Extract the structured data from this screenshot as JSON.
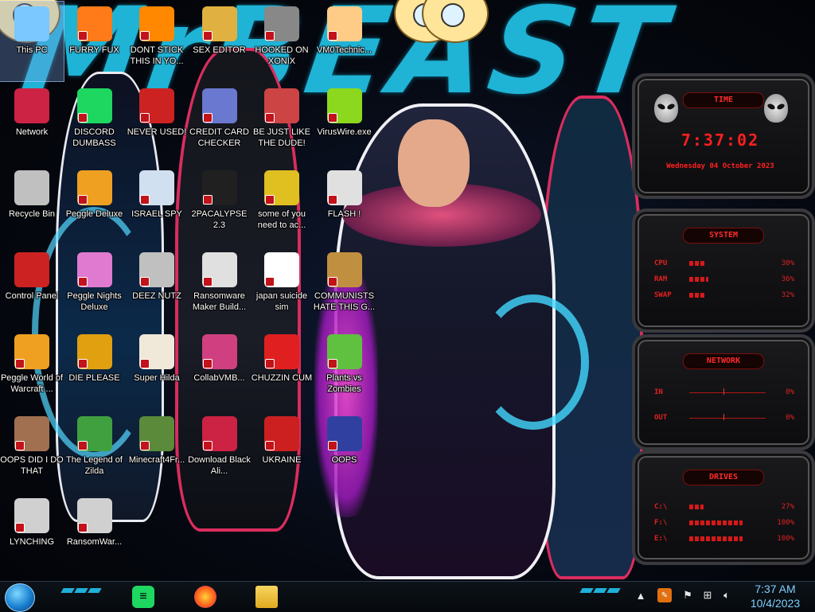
{
  "wallpaper": {
    "title": "MrBEAST"
  },
  "desktop": {
    "icons": [
      {
        "label": "This PC",
        "icon": "this-pc-icon",
        "color": "#7ac8ff"
      },
      {
        "label": "FURRY FUX",
        "icon": "firefox-icon",
        "color": "#ff7a18"
      },
      {
        "label": "DONT STICK THIS IN YO...",
        "icon": "vlc-cone-icon",
        "color": "#ff8800"
      },
      {
        "label": "SEX EDITOR",
        "icon": "hex-editor-icon",
        "color": "#e0b040"
      },
      {
        "label": "HOOKED ON XONIX",
        "icon": "xonix-game-icon",
        "color": "#888888"
      },
      {
        "label": "VM0Technic...",
        "icon": "doctor-icon",
        "color": "#ffcc88"
      },
      {
        "label": "Network",
        "icon": "network-icon",
        "color": "#cc2244"
      },
      {
        "label": "DISCORD DUMBASS",
        "icon": "spotify-icon",
        "color": "#1ed760"
      },
      {
        "label": "NEVER USED!",
        "icon": "dev-cpp-icon",
        "color": "#cc2222"
      },
      {
        "label": "CREDIT CARD CHECKER",
        "icon": "credit-card-icon",
        "color": "#6a78d0"
      },
      {
        "label": "BE JUST LIKE THE DUDE!",
        "icon": "elf-face-icon",
        "color": "#cc4444"
      },
      {
        "label": "VirusWire.exe",
        "icon": "lime-icon",
        "color": "#8bd81e"
      },
      {
        "label": "Recycle Bin",
        "icon": "recycle-bin-icon",
        "color": "#c0c0c0"
      },
      {
        "label": "Peggle Deluxe",
        "icon": "peggle-icon",
        "color": "#f0a020"
      },
      {
        "label": "ISRAEL SPY",
        "icon": "spy-app-icon",
        "color": "#d0e0f0"
      },
      {
        "label": "2PACALYPSE 2.3",
        "icon": "terminal-icon",
        "color": "#202020"
      },
      {
        "label": "some of you need to ac...",
        "icon": "beaver-icon",
        "color": "#e0c020"
      },
      {
        "label": "FLASH !",
        "icon": "flash-doc-icon",
        "color": "#e0e0e0"
      },
      {
        "label": "Control Panel",
        "icon": "control-panel-icon",
        "color": "#cc2222"
      },
      {
        "label": "Peggle Nights Deluxe",
        "icon": "peggle-nights-icon",
        "color": "#e07ad0"
      },
      {
        "label": "DEEZ NUTZ",
        "icon": "windows-stack-icon",
        "color": "#c0c0c0"
      },
      {
        "label": "Ransomware Maker Build...",
        "icon": "builder-window-icon",
        "color": "#e0e0e0"
      },
      {
        "label": "japan suicide sim",
        "icon": "document-icon",
        "color": "#ffffff"
      },
      {
        "label": "COMMUNISTS HATE THIS G...",
        "icon": "money-bag-icon",
        "color": "#c09040"
      },
      {
        "label": "Peggle World of Warcraft ...",
        "icon": "peggle-wow-icon",
        "color": "#f0a020"
      },
      {
        "label": "DIE PLEASE",
        "icon": "die-icon",
        "color": "#e0a010"
      },
      {
        "label": "Super Hilda",
        "icon": "pixel-sprite-icon",
        "color": "#f0e8d8"
      },
      {
        "label": "CollabVMB...",
        "icon": "computer-screen-icon",
        "color": "#d04080"
      },
      {
        "label": "CHUZZIN CUM",
        "icon": "chuzzle-icon",
        "color": "#e02020"
      },
      {
        "label": "Plants vs Zombies",
        "icon": "plant-icon",
        "color": "#60c040"
      },
      {
        "label": "OOPS DID I DO THAT",
        "icon": "portrait-icon",
        "color": "#a07050"
      },
      {
        "label": "The Legend of Zilda",
        "icon": "pixel-hero-icon",
        "color": "#40a040"
      },
      {
        "label": "Minecraft4Fr...",
        "icon": "grass-block-icon",
        "color": "#5a8a3a"
      },
      {
        "label": "Download Black Ali...",
        "icon": "alien-orb-icon",
        "color": "#cc2244"
      },
      {
        "label": "UKRAINE",
        "icon": "radiation-icon",
        "color": "#cc2020"
      },
      {
        "label": "OOPS",
        "icon": "oops-icon",
        "color": "#3040a0"
      },
      {
        "label": "LYNCHING",
        "icon": "knot-icon",
        "color": "#d0d0d0"
      },
      {
        "label": "RansomWar...",
        "icon": "skull-icon",
        "color": "#d0d0d0"
      }
    ]
  },
  "gadgets": {
    "time": {
      "title": "TIME",
      "clock": "7:37:02",
      "date": "Wednesday 04 October 2023"
    },
    "system": {
      "title": "SYSTEM",
      "rows": [
        {
          "label": "CPU",
          "value": "30%",
          "fill": 0.3
        },
        {
          "label": "RAM",
          "value": "36%",
          "fill": 0.36
        },
        {
          "label": "SWAP",
          "value": "32%",
          "fill": 0.32
        }
      ]
    },
    "network": {
      "title": "NETWORK",
      "rows": [
        {
          "label": "IN",
          "value": "0%"
        },
        {
          "label": "OUT",
          "value": "0%"
        }
      ]
    },
    "drives": {
      "title": "DRIVES",
      "rows": [
        {
          "label": "C:\\",
          "value": "27%",
          "fill": 0.27
        },
        {
          "label": "F:\\",
          "value": "100%",
          "fill": 1.0
        },
        {
          "label": "E:\\",
          "value": "100%",
          "fill": 1.0
        }
      ]
    }
  },
  "taskbar": {
    "pinned": [
      {
        "name": "spotify",
        "icon": "spotify-icon",
        "color": "#1ed760"
      },
      {
        "name": "firefox",
        "icon": "firefox-icon",
        "color": "#ff7a18"
      },
      {
        "name": "file-explorer",
        "icon": "folder-icon",
        "color": "#f0c040"
      }
    ],
    "clock_time": "7:37 AM",
    "clock_date": "10/4/2023"
  }
}
